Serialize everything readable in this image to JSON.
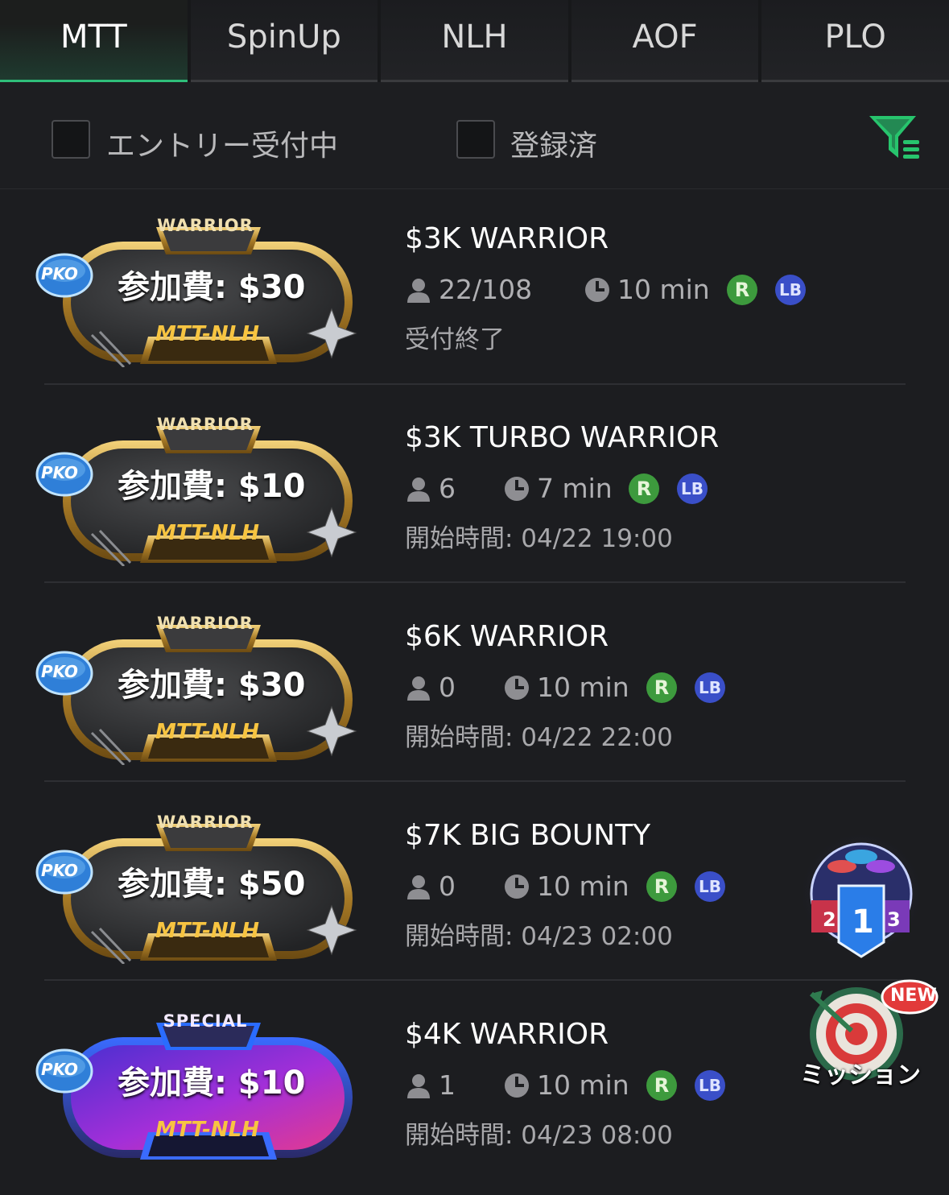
{
  "tabs": [
    {
      "label": "MTT",
      "active": true
    },
    {
      "label": "SpinUp",
      "active": false
    },
    {
      "label": "NLH",
      "active": false
    },
    {
      "label": "AOF",
      "active": false
    },
    {
      "label": "PLO",
      "active": false
    }
  ],
  "filters": {
    "entry_open_label": "エントリー受付中",
    "registered_label": "登録済",
    "filter_icon": "filter-icon"
  },
  "badge": {
    "pko_label": "PKO",
    "category_label": "MTT-NLH"
  },
  "tournaments": [
    {
      "top_label": "WARRIOR",
      "fee": "参加費: $30",
      "title": "$3K WARRIOR",
      "players": "22/108",
      "level": "10 min",
      "r": "R",
      "lb": "LB",
      "status": "受付終了",
      "style": "warrior"
    },
    {
      "top_label": "WARRIOR",
      "fee": "参加費: $10",
      "title": "$3K TURBO WARRIOR",
      "players": "6",
      "level": "7 min",
      "r": "R",
      "lb": "LB",
      "status": "開始時間: 04/22 19:00",
      "style": "warrior"
    },
    {
      "top_label": "WARRIOR",
      "fee": "参加費: $30",
      "title": "$6K WARRIOR",
      "players": "0",
      "level": "10 min",
      "r": "R",
      "lb": "LB",
      "status": "開始時間: 04/22 22:00",
      "style": "warrior"
    },
    {
      "top_label": "WARRIOR",
      "fee": "参加費: $50",
      "title": "$7K BIG BOUNTY",
      "players": "0",
      "level": "10 min",
      "r": "R",
      "lb": "LB",
      "status": "開始時間: 04/23 02:00",
      "style": "warrior"
    },
    {
      "top_label": "SPECIAL",
      "fee": "参加費: $10",
      "title": "$4K WARRIOR",
      "players": "1",
      "level": "10 min",
      "r": "R",
      "lb": "LB",
      "status": "開始時間: 04/23 08:00",
      "style": "special"
    }
  ],
  "floating": {
    "ranking_labels": [
      "2",
      "1",
      "3"
    ],
    "mission_label": "ミッション",
    "mission_new_label": "NEW"
  }
}
